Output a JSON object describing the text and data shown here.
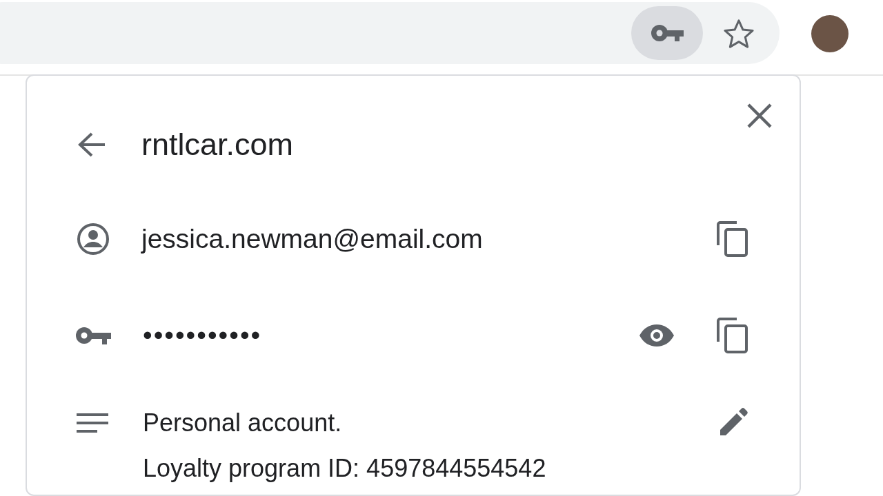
{
  "toolbar": {
    "key_button": {
      "selected": true
    }
  },
  "popup": {
    "title": "rntlcar.com",
    "username": "jessica.newman@email.com",
    "password": "•••••••••••",
    "note_lines": [
      "Personal account.",
      "Loyalty program ID: 4597844554542"
    ]
  }
}
